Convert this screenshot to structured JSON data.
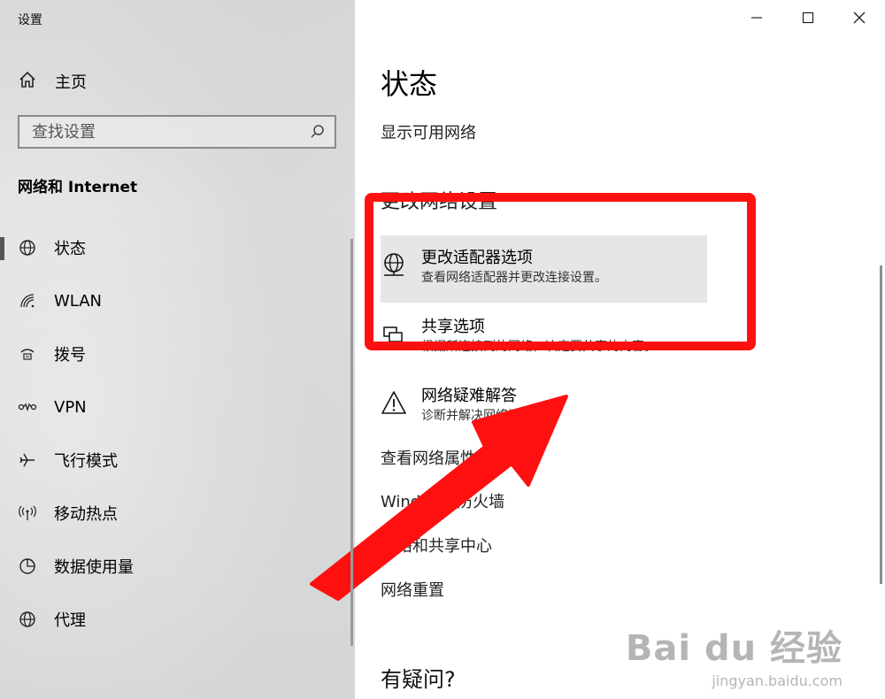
{
  "window": {
    "title": "设置"
  },
  "sidebar": {
    "home_label": "主页",
    "search_placeholder": "查找设置",
    "section_title": "网络和 Internet",
    "items": [
      {
        "label": "状态",
        "icon": "globe-icon",
        "active": true
      },
      {
        "label": "WLAN",
        "icon": "wifi-icon"
      },
      {
        "label": "拨号",
        "icon": "dialup-icon"
      },
      {
        "label": "VPN",
        "icon": "vpn-icon"
      },
      {
        "label": "飞行模式",
        "icon": "airplane-icon"
      },
      {
        "label": "移动热点",
        "icon": "hotspot-icon"
      },
      {
        "label": "数据使用量",
        "icon": "data-usage-icon"
      },
      {
        "label": "代理",
        "icon": "globe-icon"
      }
    ]
  },
  "main": {
    "title": "状态",
    "show_networks": "显示可用网络",
    "advanced_heading": "更改网络设置",
    "options": [
      {
        "title": "更改适配器选项",
        "desc": "查看网络适配器并更改连接设置。",
        "icon": "adapter-globe-icon"
      },
      {
        "title": "共享选项",
        "desc": "根据所连接到的网络，决定要共享的内容。",
        "icon": "sharing-icon"
      },
      {
        "title": "网络疑难解答",
        "desc": "诊断并解决网络问题。",
        "icon": "warning-icon"
      }
    ],
    "links": [
      "查看网络属性",
      "Windows 防火墙",
      "网络和共享中心",
      "网络重置"
    ],
    "help_heading": "有疑问?"
  },
  "watermark": {
    "main": "Bai du 经验",
    "sub": "jingyan.baidu.com"
  },
  "colors": {
    "annotation": "#ff1010",
    "sidebar_bg": "#dcdcdc",
    "highlight": "#e6e6e6"
  }
}
